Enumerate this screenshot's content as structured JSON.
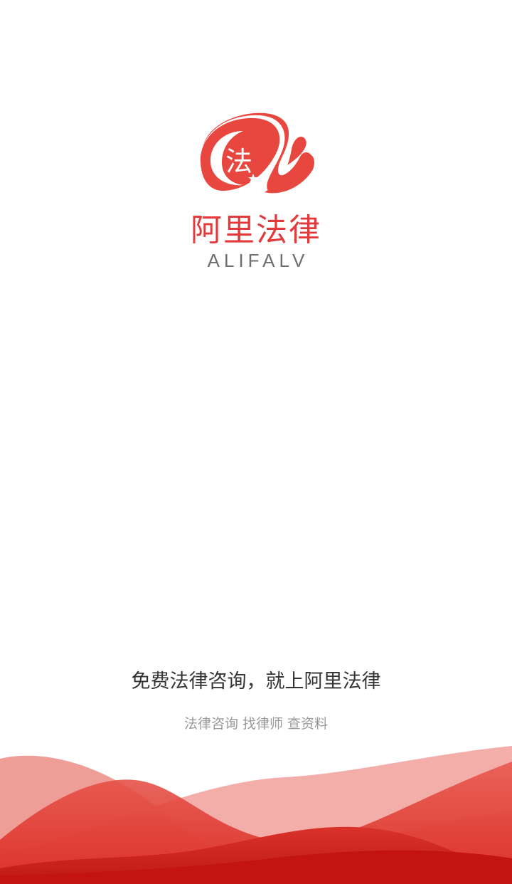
{
  "splash": {
    "brand_name": "阿里法律",
    "brand_latin": "ALIFALV",
    "logo_glyph": "法",
    "slogan": "免费法律咨询，就上阿里法律",
    "subline": "法律咨询 找律师 查资料"
  },
  "colors": {
    "brand_red": "#e8473f",
    "brand_blue": "#3ab4e6",
    "latin_gray": "#6e6e6e"
  },
  "icons": {
    "logo": "alifalv-logo-icon"
  }
}
